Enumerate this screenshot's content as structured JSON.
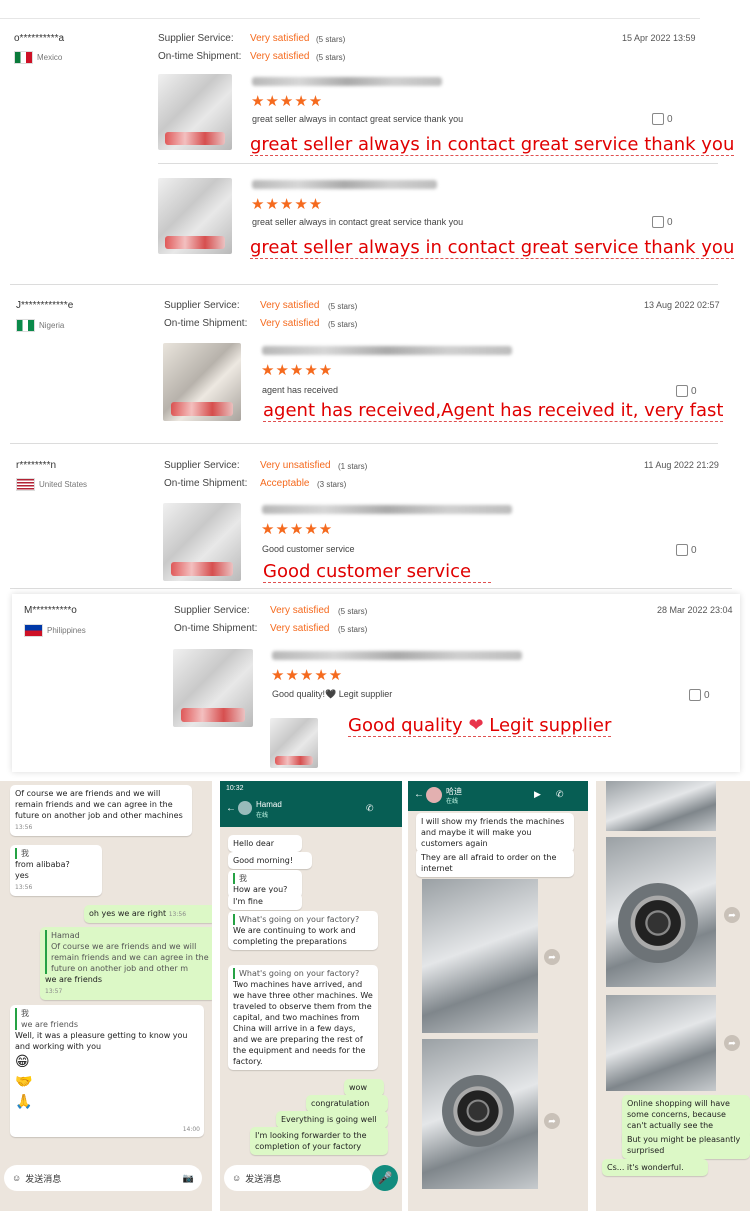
{
  "labels": {
    "supplier_service": "Supplier Service:",
    "ontime_shipment": "On-time Shipment:"
  },
  "reviews": [
    {
      "user": "o**********a",
      "country": "Mexico",
      "supplier": "Very satisfied",
      "supplier_stars": "(5 stars)",
      "shipment": "Very satisfied",
      "shipment_stars": "(5 stars)",
      "date": "15 Apr 2022 13:59",
      "entries": [
        {
          "stars": "★★★★★",
          "comment": "great seller always in contact great service thank you",
          "likes": "0",
          "annotation": "great seller always in contact great service thank you"
        },
        {
          "stars": "★★★★★",
          "comment": "great seller always in contact great service thank you",
          "likes": "0",
          "annotation": "great seller always in contact great service thank you"
        }
      ]
    },
    {
      "user": "J************e",
      "country": "Nigeria",
      "supplier": "Very satisfied",
      "supplier_stars": "(5 stars)",
      "shipment": "Very satisfied",
      "shipment_stars": "(5 stars)",
      "date": "13 Aug 2022 02:57",
      "entries": [
        {
          "stars": "★★★★★",
          "comment": "agent has received",
          "likes": "0",
          "annotation": "agent has received,Agent has received it, very fast"
        }
      ]
    },
    {
      "user": "r********n",
      "country": "United States",
      "supplier": "Very unsatisfied",
      "supplier_stars": "(1 stars)",
      "shipment": "Acceptable",
      "shipment_stars": "(3 stars)",
      "date": "11 Aug 2022 21:29",
      "entries": [
        {
          "stars": "★★★★★",
          "comment": "Good customer service",
          "likes": "0",
          "annotation": "Good customer service"
        }
      ]
    },
    {
      "user": "M**********o",
      "country": "Philippines",
      "supplier": "Very satisfied",
      "supplier_stars": "(5 stars)",
      "shipment": "Very satisfied",
      "shipment_stars": "(5 stars)",
      "date": "28 Mar 2022 23:04",
      "entries": [
        {
          "stars": "★★★★★",
          "comment": "Good quality!🖤 Legit supplier",
          "likes": "0",
          "annotation_a": "Good quality",
          "annotation_heart": "❤",
          "annotation_b": "Legit supplier"
        }
      ]
    }
  ],
  "colors": {
    "accent": "#f56a1e",
    "annotation": "#e00000",
    "whatsapp_header": "#075e54",
    "whatsapp_bubble": "#dcf8c6"
  },
  "chat1": {
    "m1": "Of course we are friends and we will remain friends and we can agree in the future on another job and other machines",
    "m1t": "13:56",
    "m2q": "我",
    "m2": "from alibaba?",
    "m2b": "yes",
    "m2t": "13:56",
    "m3": "oh yes we are right",
    "m3t": "13:56",
    "m4q": "Hamad",
    "m4": "Of course we are friends and we will remain friends and we can agree in the future on another job and other m",
    "m4b": "we are friends",
    "m4t": "13:57",
    "m5q": "我",
    "m5a": "we are friends",
    "m5": "Well, it was a pleasure getting to know you and working with you",
    "m5t": "14:00",
    "e1": "😁",
    "e2": "🤝",
    "e3": "🙏",
    "input": "发送消息"
  },
  "chat2": {
    "time": "10:32",
    "contact": "Hamad",
    "sub": "在线",
    "b1": "Hello dear",
    "b2": "Good morning!",
    "b3q": "我",
    "b3": "How are you?",
    "b4": "I'm fine",
    "b5q": "What's going on your factory?",
    "b5": "We are continuing to work and completing the preparations",
    "b6q": "What's going on your factory?",
    "b6": "Two machines have arrived, and we have three other machines. We traveled to observe them from the capital, and two machines from China will arrive in a few days, and we are preparing the rest of the equipment and needs for the factory.",
    "b7": "wow",
    "b8": "congratulation",
    "b9": "Everything is going well",
    "b10": "I'm looking forwarder to the completion of your factory",
    "input": "发送消息"
  },
  "chat3": {
    "contact": "哈迪",
    "sub": "在线",
    "b1": "I will show my friends the machines and maybe it will make you customers again",
    "b2": "They are all afraid to order on the internet"
  },
  "chat4": {
    "b1": "Online shopping will have some concerns, because can't actually see the product.",
    "b2": "But you might be pleasantly surprised",
    "b3": "Cs... it's wonderful."
  }
}
